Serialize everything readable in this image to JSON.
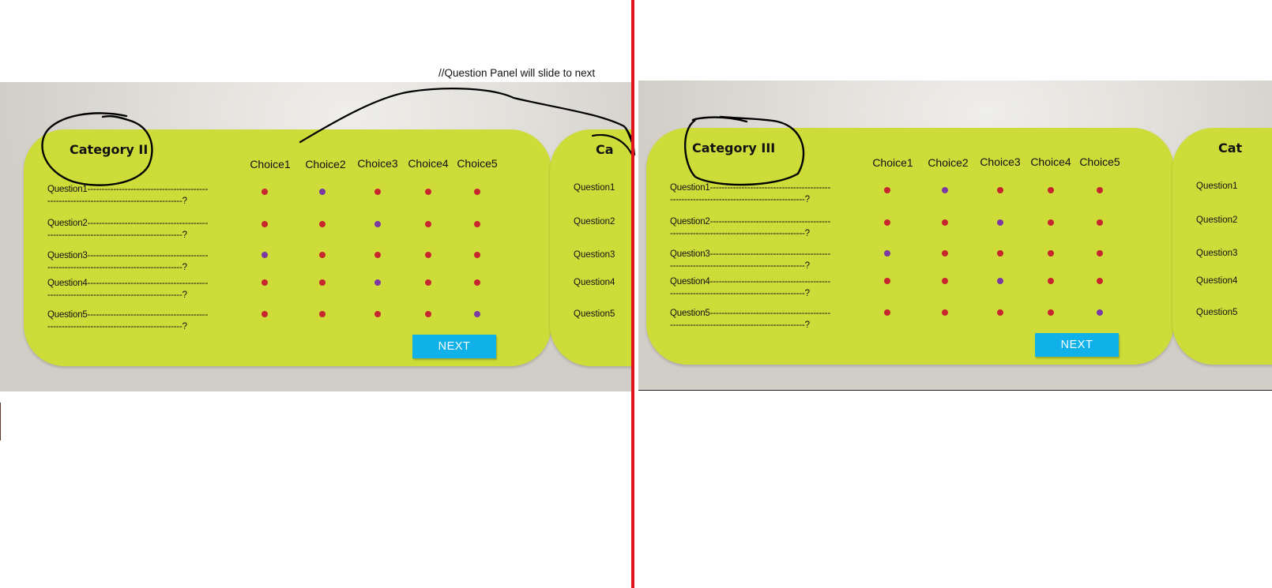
{
  "annotation": "//Question Panel will slide to next",
  "choices": [
    "Choice1",
    "Choice2",
    "Choice3",
    "Choice4",
    "Choice5"
  ],
  "questions": [
    {
      "label": "Question1",
      "tail": "?",
      "selected": 2
    },
    {
      "label": "Question2",
      "tail": "?",
      "selected": 3
    },
    {
      "label": "Question3",
      "tail": "?",
      "selected": 1
    },
    {
      "label": "Question4",
      "tail": "?",
      "selected": 3
    },
    {
      "label": "Question5",
      "tail": "?",
      "selected": 5
    }
  ],
  "next_label": "NEXT",
  "panels": [
    {
      "category": "Category II",
      "next_category_peek": "Ca"
    },
    {
      "category": "Category III",
      "next_category_peek": "Cat"
    }
  ],
  "colors": {
    "panel": "#cedc3a",
    "unselected_dot": "#c8262e",
    "selected_dot": "#7b3aa3",
    "next_button": "#10b1e8",
    "divider": "#e0151b"
  }
}
